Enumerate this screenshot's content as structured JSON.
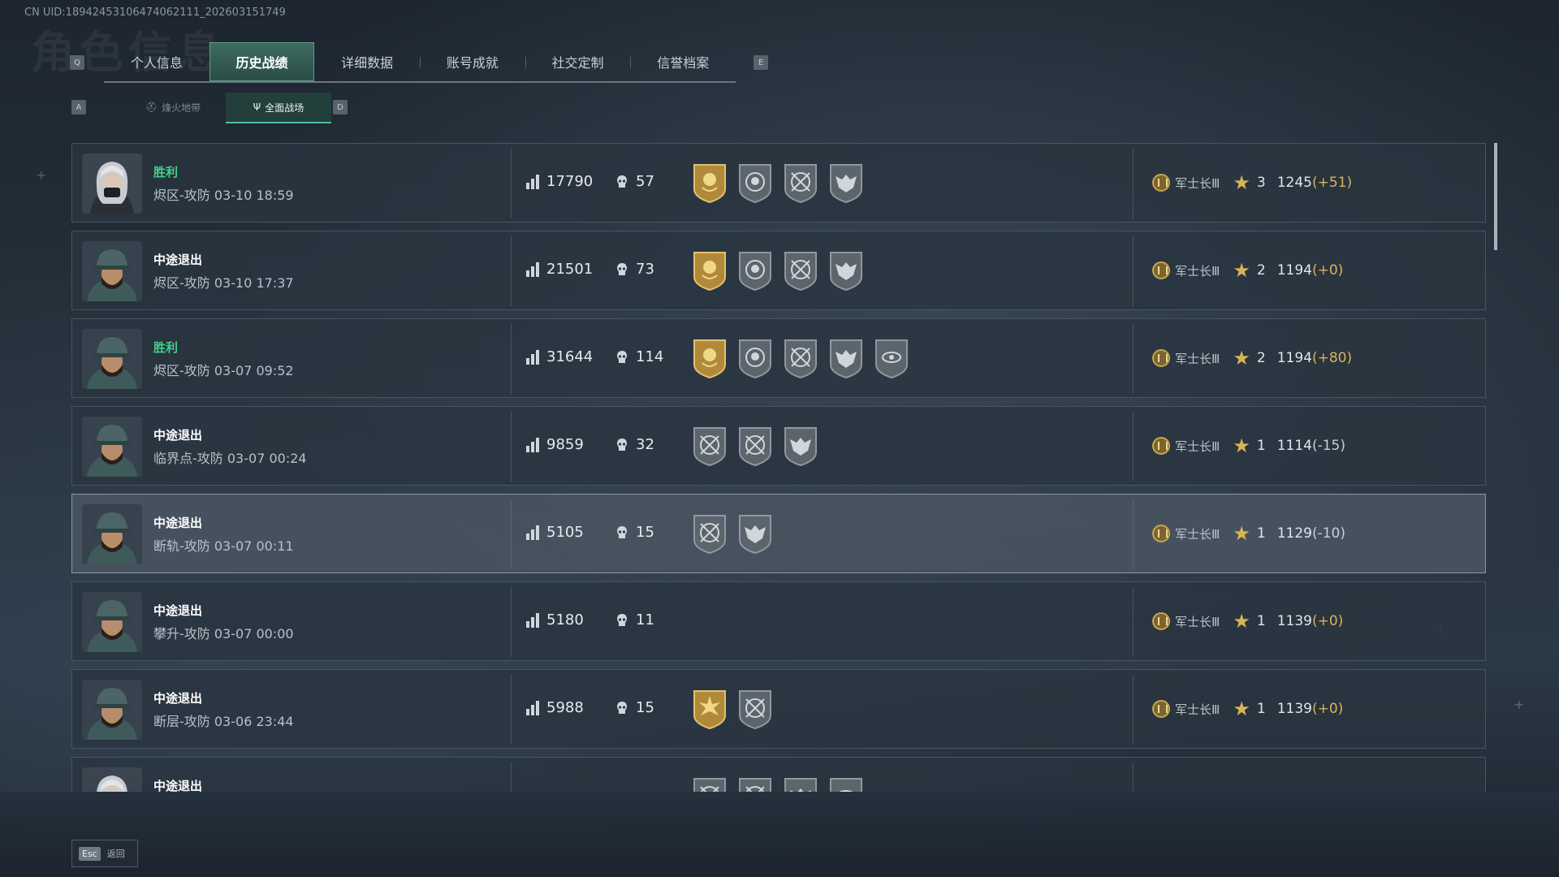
{
  "uid_text": "CN UID:18942453106474062111_202603151749",
  "bg_title": "角色信息",
  "tabs": {
    "key_left": "Q",
    "key_right": "E",
    "items": [
      {
        "label": "个人信息",
        "active": false
      },
      {
        "label": "历史战绩",
        "active": true
      },
      {
        "label": "详细数据",
        "active": false
      },
      {
        "label": "账号成就",
        "active": false
      },
      {
        "label": "社交定制",
        "active": false
      },
      {
        "label": "信誉档案",
        "active": false
      }
    ]
  },
  "subtabs": {
    "key_left": "A",
    "key_right": "D",
    "items": [
      {
        "label": "烽火地带",
        "icon": "helmet-icon",
        "active": false
      },
      {
        "label": "全面战场",
        "icon": "trident-icon",
        "active": true
      }
    ]
  },
  "matches": [
    {
      "result": "胜利",
      "win": true,
      "avatar": "female-operator",
      "map": "烬区-攻防",
      "time": "03-10 18:59",
      "score": "17790",
      "kills": "57",
      "badges": [
        "gold-rose",
        "skull-target",
        "crossed-rifles",
        "winged-skull"
      ],
      "rank": "军士长Ⅲ",
      "level": "3",
      "points": "1245",
      "delta": "(+51)",
      "delta_neg": false
    },
    {
      "result": "中途退出",
      "win": false,
      "avatar": "male-operator",
      "map": "烬区-攻防",
      "time": "03-10 17:37",
      "score": "21501",
      "kills": "73",
      "badges": [
        "gold-rose",
        "skull-target",
        "crossed-rifles",
        "winged-skull"
      ],
      "rank": "军士长Ⅲ",
      "level": "2",
      "points": "1194",
      "delta": "(+0)",
      "delta_neg": false
    },
    {
      "result": "胜利",
      "win": true,
      "avatar": "male-operator",
      "map": "烬区-攻防",
      "time": "03-07 09:52",
      "score": "31644",
      "kills": "114",
      "badges": [
        "gold-rose",
        "skull-target",
        "crossed-rifles",
        "winged-skull",
        "eye-scope"
      ],
      "rank": "军士长Ⅲ",
      "level": "2",
      "points": "1194",
      "delta": "(+80)",
      "delta_neg": false
    },
    {
      "result": "中途退出",
      "win": false,
      "avatar": "male-operator",
      "map": "临界点-攻防",
      "time": "03-07 00:24",
      "score": "9859",
      "kills": "32",
      "badges": [
        "crossed-rifles",
        "crossed-rifles",
        "winged-skull"
      ],
      "rank": "军士长Ⅲ",
      "level": "1",
      "points": "1114",
      "delta": "(-15)",
      "delta_neg": true
    },
    {
      "result": "中途退出",
      "win": false,
      "avatar": "male-operator",
      "map": "断轨-攻防",
      "time": "03-07 00:11",
      "score": "5105",
      "kills": "15",
      "badges": [
        "crossed-rifles",
        "winged-skull"
      ],
      "rank": "军士长Ⅲ",
      "level": "1",
      "points": "1129",
      "delta": "(-10)",
      "delta_neg": true
    },
    {
      "result": "中途退出",
      "win": false,
      "avatar": "male-operator",
      "map": "攀升-攻防",
      "time": "03-07 00:00",
      "score": "5180",
      "kills": "11",
      "badges": [],
      "rank": "军士长Ⅲ",
      "level": "1",
      "points": "1139",
      "delta": "(+0)",
      "delta_neg": false
    },
    {
      "result": "中途退出",
      "win": false,
      "avatar": "male-operator",
      "map": "断层-攻防",
      "time": "03-06 23:44",
      "score": "5988",
      "kills": "15",
      "badges": [
        "gold-burst",
        "crossed-rifles"
      ],
      "rank": "军士长Ⅲ",
      "level": "1",
      "points": "1139",
      "delta": "(+0)",
      "delta_neg": false
    },
    {
      "result": "中途退出",
      "win": false,
      "avatar": "female-operator",
      "map": "",
      "time": "",
      "score": "",
      "kills": "",
      "badges": [
        "crossed-rifles",
        "crossed-rifles",
        "winged-skull",
        "eye-scope"
      ],
      "rank": "",
      "level": "",
      "points": "",
      "delta": "",
      "delta_neg": false
    }
  ],
  "footer": {
    "esc_key": "Esc",
    "esc_label": "返回"
  },
  "colors": {
    "win": "#42d18a",
    "gold": "#d9b457",
    "accent": "#4fbf9e"
  }
}
